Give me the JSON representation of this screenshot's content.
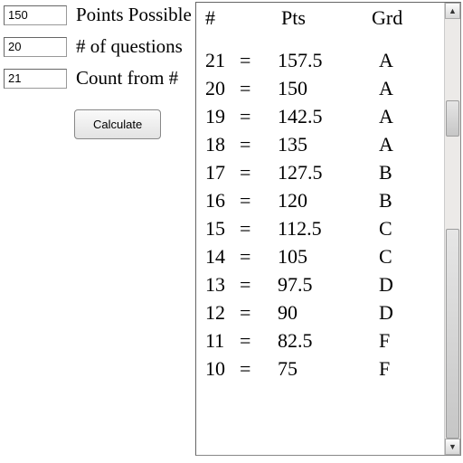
{
  "inputs": {
    "points_possible": {
      "value": "150",
      "label": "Points Possible"
    },
    "num_questions": {
      "value": "20",
      "label": "# of questions"
    },
    "count_from": {
      "value": "21",
      "label": "Count from #"
    }
  },
  "buttons": {
    "calculate": "Calculate"
  },
  "results": {
    "headers": {
      "num": "#",
      "pts": "Pts",
      "grd": "Grd"
    },
    "eq": "=",
    "rows": [
      {
        "n": "21",
        "pts": "157.5",
        "grd": "A"
      },
      {
        "n": "20",
        "pts": "150",
        "grd": "A"
      },
      {
        "n": "19",
        "pts": "142.5",
        "grd": "A"
      },
      {
        "n": "18",
        "pts": "135",
        "grd": "A"
      },
      {
        "n": "17",
        "pts": "127.5",
        "grd": "B"
      },
      {
        "n": "16",
        "pts": "120",
        "grd": "B"
      },
      {
        "n": "15",
        "pts": "112.5",
        "grd": "C"
      },
      {
        "n": "14",
        "pts": "105",
        "grd": "C"
      },
      {
        "n": "13",
        "pts": "97.5",
        "grd": "D"
      },
      {
        "n": "12",
        "pts": "90",
        "grd": "D"
      },
      {
        "n": "11",
        "pts": "82.5",
        "grd": "F"
      },
      {
        "n": "10",
        "pts": "75",
        "grd": "F"
      }
    ]
  }
}
